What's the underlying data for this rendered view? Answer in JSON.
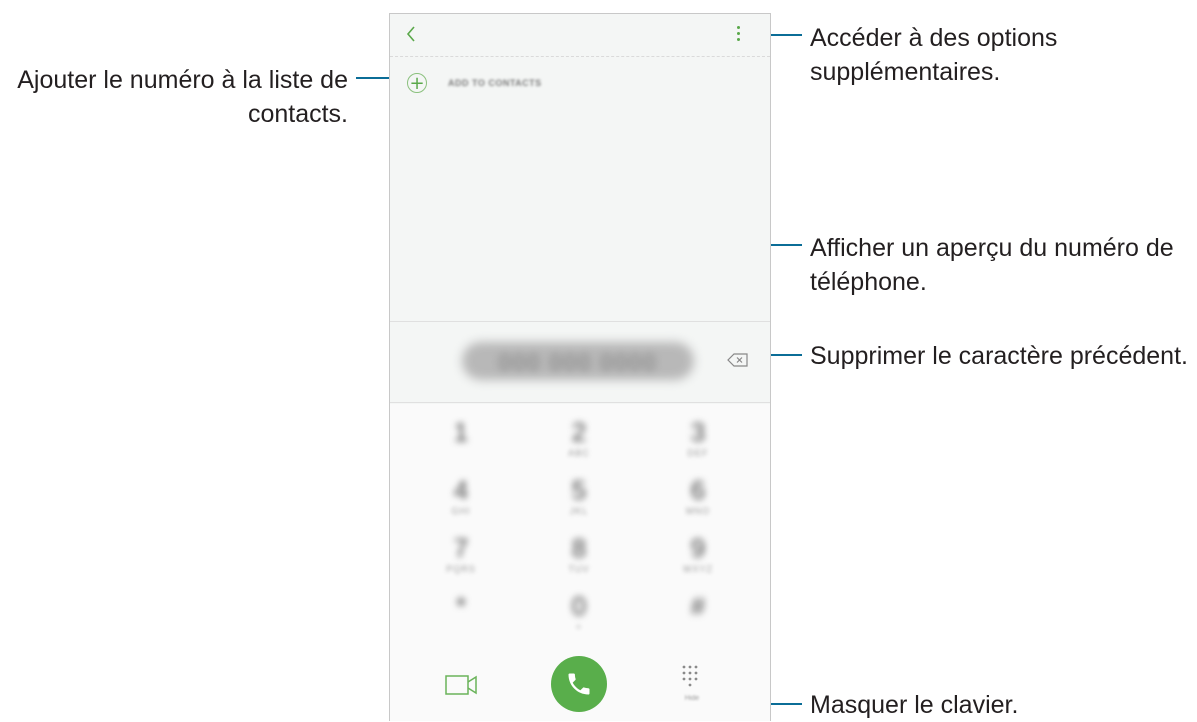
{
  "callouts": {
    "add_to_contacts": [
      "Ajouter le numéro à la liste de",
      "contacts."
    ],
    "more_options": [
      "Accéder à des options",
      "supplémentaires."
    ],
    "number_preview": [
      "Afficher un aperçu du numéro de",
      "téléphone."
    ],
    "delete_char": "Supprimer le caractère précédent.",
    "hide_keypad": "Masquer le clavier."
  },
  "phone": {
    "back_icon": "chevron-left-icon",
    "more_icon": "more-vertical-icon",
    "add_contacts_label": "ADD TO CONTACTS",
    "number_value": "000 000 0000",
    "keys": [
      {
        "digit": "1",
        "letters": ""
      },
      {
        "digit": "2",
        "letters": "ABC"
      },
      {
        "digit": "3",
        "letters": "DEF"
      },
      {
        "digit": "4",
        "letters": "GHI"
      },
      {
        "digit": "5",
        "letters": "JKL"
      },
      {
        "digit": "6",
        "letters": "MNO"
      },
      {
        "digit": "7",
        "letters": "PQRS"
      },
      {
        "digit": "8",
        "letters": "TUV"
      },
      {
        "digit": "9",
        "letters": "WXYZ"
      },
      {
        "digit": "*",
        "letters": ""
      },
      {
        "digit": "0",
        "letters": "+"
      },
      {
        "digit": "#",
        "letters": ""
      }
    ],
    "hide_label": "Hide"
  },
  "colors": {
    "accent_green": "#59ae4b",
    "callout_line": "#0b6d97",
    "text": "#231f20"
  }
}
